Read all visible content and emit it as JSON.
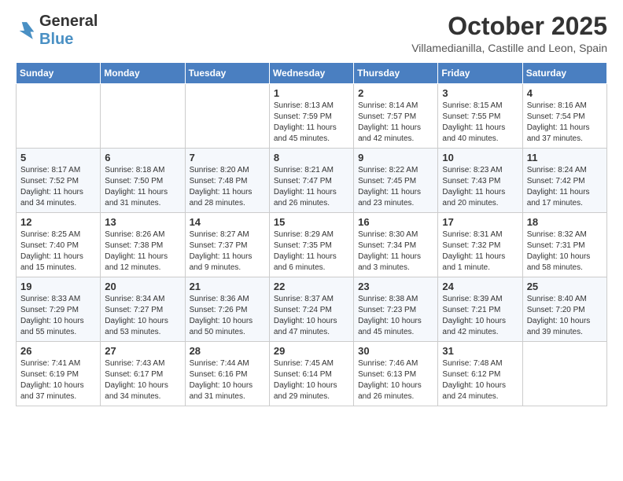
{
  "header": {
    "logo_general": "General",
    "logo_blue": "Blue",
    "month_title": "October 2025",
    "location": "Villamedianilla, Castille and Leon, Spain"
  },
  "days_of_week": [
    "Sunday",
    "Monday",
    "Tuesday",
    "Wednesday",
    "Thursday",
    "Friday",
    "Saturday"
  ],
  "weeks": [
    [
      {
        "day": "",
        "sunrise": "",
        "sunset": "",
        "daylight": ""
      },
      {
        "day": "",
        "sunrise": "",
        "sunset": "",
        "daylight": ""
      },
      {
        "day": "",
        "sunrise": "",
        "sunset": "",
        "daylight": ""
      },
      {
        "day": "1",
        "sunrise": "Sunrise: 8:13 AM",
        "sunset": "Sunset: 7:59 PM",
        "daylight": "Daylight: 11 hours and 45 minutes."
      },
      {
        "day": "2",
        "sunrise": "Sunrise: 8:14 AM",
        "sunset": "Sunset: 7:57 PM",
        "daylight": "Daylight: 11 hours and 42 minutes."
      },
      {
        "day": "3",
        "sunrise": "Sunrise: 8:15 AM",
        "sunset": "Sunset: 7:55 PM",
        "daylight": "Daylight: 11 hours and 40 minutes."
      },
      {
        "day": "4",
        "sunrise": "Sunrise: 8:16 AM",
        "sunset": "Sunset: 7:54 PM",
        "daylight": "Daylight: 11 hours and 37 minutes."
      }
    ],
    [
      {
        "day": "5",
        "sunrise": "Sunrise: 8:17 AM",
        "sunset": "Sunset: 7:52 PM",
        "daylight": "Daylight: 11 hours and 34 minutes."
      },
      {
        "day": "6",
        "sunrise": "Sunrise: 8:18 AM",
        "sunset": "Sunset: 7:50 PM",
        "daylight": "Daylight: 11 hours and 31 minutes."
      },
      {
        "day": "7",
        "sunrise": "Sunrise: 8:20 AM",
        "sunset": "Sunset: 7:48 PM",
        "daylight": "Daylight: 11 hours and 28 minutes."
      },
      {
        "day": "8",
        "sunrise": "Sunrise: 8:21 AM",
        "sunset": "Sunset: 7:47 PM",
        "daylight": "Daylight: 11 hours and 26 minutes."
      },
      {
        "day": "9",
        "sunrise": "Sunrise: 8:22 AM",
        "sunset": "Sunset: 7:45 PM",
        "daylight": "Daylight: 11 hours and 23 minutes."
      },
      {
        "day": "10",
        "sunrise": "Sunrise: 8:23 AM",
        "sunset": "Sunset: 7:43 PM",
        "daylight": "Daylight: 11 hours and 20 minutes."
      },
      {
        "day": "11",
        "sunrise": "Sunrise: 8:24 AM",
        "sunset": "Sunset: 7:42 PM",
        "daylight": "Daylight: 11 hours and 17 minutes."
      }
    ],
    [
      {
        "day": "12",
        "sunrise": "Sunrise: 8:25 AM",
        "sunset": "Sunset: 7:40 PM",
        "daylight": "Daylight: 11 hours and 15 minutes."
      },
      {
        "day": "13",
        "sunrise": "Sunrise: 8:26 AM",
        "sunset": "Sunset: 7:38 PM",
        "daylight": "Daylight: 11 hours and 12 minutes."
      },
      {
        "day": "14",
        "sunrise": "Sunrise: 8:27 AM",
        "sunset": "Sunset: 7:37 PM",
        "daylight": "Daylight: 11 hours and 9 minutes."
      },
      {
        "day": "15",
        "sunrise": "Sunrise: 8:29 AM",
        "sunset": "Sunset: 7:35 PM",
        "daylight": "Daylight: 11 hours and 6 minutes."
      },
      {
        "day": "16",
        "sunrise": "Sunrise: 8:30 AM",
        "sunset": "Sunset: 7:34 PM",
        "daylight": "Daylight: 11 hours and 3 minutes."
      },
      {
        "day": "17",
        "sunrise": "Sunrise: 8:31 AM",
        "sunset": "Sunset: 7:32 PM",
        "daylight": "Daylight: 11 hours and 1 minute."
      },
      {
        "day": "18",
        "sunrise": "Sunrise: 8:32 AM",
        "sunset": "Sunset: 7:31 PM",
        "daylight": "Daylight: 10 hours and 58 minutes."
      }
    ],
    [
      {
        "day": "19",
        "sunrise": "Sunrise: 8:33 AM",
        "sunset": "Sunset: 7:29 PM",
        "daylight": "Daylight: 10 hours and 55 minutes."
      },
      {
        "day": "20",
        "sunrise": "Sunrise: 8:34 AM",
        "sunset": "Sunset: 7:27 PM",
        "daylight": "Daylight: 10 hours and 53 minutes."
      },
      {
        "day": "21",
        "sunrise": "Sunrise: 8:36 AM",
        "sunset": "Sunset: 7:26 PM",
        "daylight": "Daylight: 10 hours and 50 minutes."
      },
      {
        "day": "22",
        "sunrise": "Sunrise: 8:37 AM",
        "sunset": "Sunset: 7:24 PM",
        "daylight": "Daylight: 10 hours and 47 minutes."
      },
      {
        "day": "23",
        "sunrise": "Sunrise: 8:38 AM",
        "sunset": "Sunset: 7:23 PM",
        "daylight": "Daylight: 10 hours and 45 minutes."
      },
      {
        "day": "24",
        "sunrise": "Sunrise: 8:39 AM",
        "sunset": "Sunset: 7:21 PM",
        "daylight": "Daylight: 10 hours and 42 minutes."
      },
      {
        "day": "25",
        "sunrise": "Sunrise: 8:40 AM",
        "sunset": "Sunset: 7:20 PM",
        "daylight": "Daylight: 10 hours and 39 minutes."
      }
    ],
    [
      {
        "day": "26",
        "sunrise": "Sunrise: 7:41 AM",
        "sunset": "Sunset: 6:19 PM",
        "daylight": "Daylight: 10 hours and 37 minutes."
      },
      {
        "day": "27",
        "sunrise": "Sunrise: 7:43 AM",
        "sunset": "Sunset: 6:17 PM",
        "daylight": "Daylight: 10 hours and 34 minutes."
      },
      {
        "day": "28",
        "sunrise": "Sunrise: 7:44 AM",
        "sunset": "Sunset: 6:16 PM",
        "daylight": "Daylight: 10 hours and 31 minutes."
      },
      {
        "day": "29",
        "sunrise": "Sunrise: 7:45 AM",
        "sunset": "Sunset: 6:14 PM",
        "daylight": "Daylight: 10 hours and 29 minutes."
      },
      {
        "day": "30",
        "sunrise": "Sunrise: 7:46 AM",
        "sunset": "Sunset: 6:13 PM",
        "daylight": "Daylight: 10 hours and 26 minutes."
      },
      {
        "day": "31",
        "sunrise": "Sunrise: 7:48 AM",
        "sunset": "Sunset: 6:12 PM",
        "daylight": "Daylight: 10 hours and 24 minutes."
      },
      {
        "day": "",
        "sunrise": "",
        "sunset": "",
        "daylight": ""
      }
    ]
  ]
}
